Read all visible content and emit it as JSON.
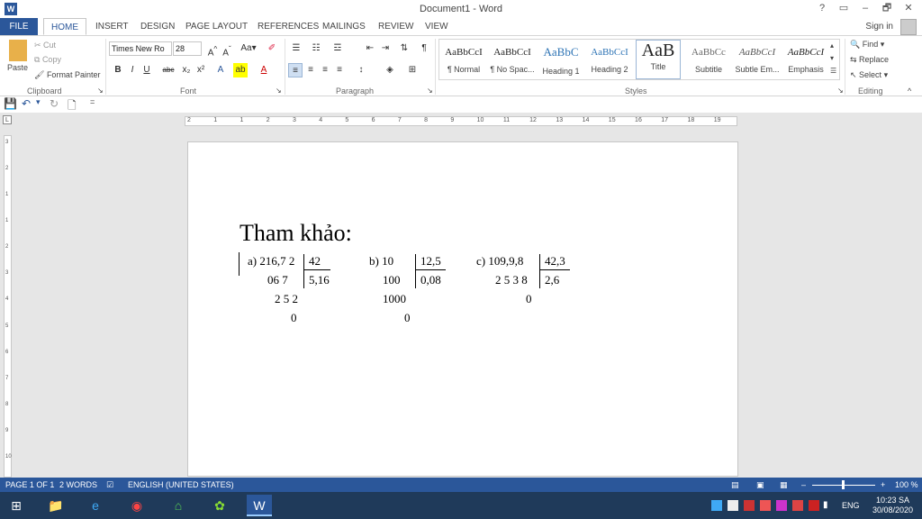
{
  "window": {
    "title": "Document1 - Word",
    "help": "?",
    "minimize": "–",
    "restore": "🗗",
    "close": "✕"
  },
  "tabs": [
    "FILE",
    "HOME",
    "INSERT",
    "DESIGN",
    "PAGE LAYOUT",
    "REFERENCES",
    "MAILINGS",
    "REVIEW",
    "VIEW"
  ],
  "signin": "Sign in",
  "ribbon": {
    "clipboard": {
      "label": "Clipboard",
      "paste": "Paste",
      "cut": "Cut",
      "copy": "Copy",
      "format_painter": "Format Painter"
    },
    "font": {
      "label": "Font",
      "font_name": "Times New Ro",
      "font_size": "28"
    },
    "paragraph": {
      "label": "Paragraph"
    },
    "styles": {
      "label": "Styles",
      "items": [
        {
          "sample": "AaBbCcI",
          "name": "¶ Normal"
        },
        {
          "sample": "AaBbCcI",
          "name": "¶ No Spac..."
        },
        {
          "sample": "AaBbC",
          "name": "Heading 1"
        },
        {
          "sample": "AaBbCcI",
          "name": "Heading 2"
        },
        {
          "sample": "AaB",
          "name": "Title"
        },
        {
          "sample": "AaBbCc",
          "name": "Subtitle"
        },
        {
          "sample": "AaBbCcI",
          "name": "Subtle Em..."
        },
        {
          "sample": "AaBbCcI",
          "name": "Emphasis"
        }
      ]
    },
    "editing": {
      "label": "Editing",
      "find": "Find",
      "replace": "Replace",
      "select": "Select"
    }
  },
  "ruler": {
    "numbers": [
      "2",
      "1",
      "1",
      "2",
      "3",
      "4",
      "5",
      "6",
      "7",
      "8",
      "9",
      "10",
      "11",
      "12",
      "13",
      "14",
      "15",
      "16",
      "17",
      "18",
      "19"
    ]
  },
  "vruler": {
    "numbers": [
      "3",
      "2",
      "1",
      "1",
      "2",
      "3",
      "4",
      "5",
      "6",
      "7",
      "8",
      "9",
      "10"
    ]
  },
  "document": {
    "title": "Tham khảo:",
    "a": {
      "label": "a) 216,7 2",
      "divisor": "42",
      "r1": "06 7",
      "quotient": "5,16",
      "r2": "2 5 2",
      "r3": "0"
    },
    "b": {
      "label": "b) 10",
      "divisor": "12,5",
      "r1": "100",
      "quotient": "0,08",
      "r2": "1000",
      "r3": "0"
    },
    "c": {
      "label": "c) 109,9,8",
      "divisor": "42,3",
      "r1": "2 5 3 8",
      "quotient": "2,6",
      "r2": "0"
    }
  },
  "status": {
    "page": "PAGE 1 OF 1",
    "words": "2 WORDS",
    "language": "ENGLISH (UNITED STATES)",
    "zoom": "100 %"
  },
  "taskbar": {
    "lang": "ENG",
    "time": "10:23 SA",
    "date": "30/08/2020"
  }
}
